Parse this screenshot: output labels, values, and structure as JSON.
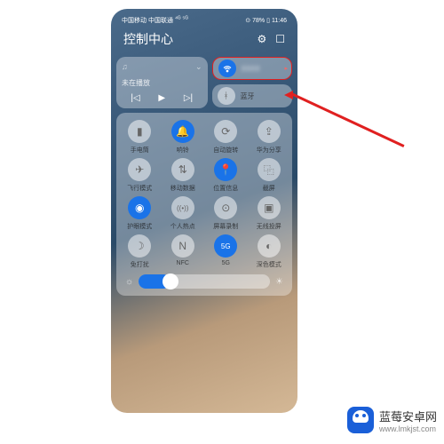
{
  "status": {
    "carrier1": "中国移动",
    "carrier2": "中国联通",
    "signal": "⁴ᴳ ⁵ᴳ",
    "vpn": "⊙",
    "battery": "78%",
    "time": "11:46"
  },
  "header": {
    "title": "控制中心"
  },
  "music": {
    "status": "未在播放",
    "prev": "|◁",
    "play": "▶",
    "next": "▷|",
    "note": "♫",
    "exp": "⌄"
  },
  "wifi": {
    "name": "XXXX"
  },
  "bt": {
    "label": "蓝牙"
  },
  "tiles": [
    {
      "label": "手电筒",
      "icon": "flashlight",
      "on": false
    },
    {
      "label": "响铃",
      "icon": "bell",
      "on": true
    },
    {
      "label": "自动旋转",
      "icon": "rotate",
      "on": false
    },
    {
      "label": "华为分享",
      "icon": "share",
      "on": false
    },
    {
      "label": "飞行模式",
      "icon": "airplane",
      "on": false
    },
    {
      "label": "移动数据",
      "icon": "data",
      "on": false
    },
    {
      "label": "位置信息",
      "icon": "location",
      "on": true
    },
    {
      "label": "截屏",
      "icon": "screenshot",
      "on": false
    },
    {
      "label": "护眼模式",
      "icon": "eye",
      "on": true
    },
    {
      "label": "个人热点",
      "icon": "hotspot",
      "on": false
    },
    {
      "label": "屏幕录制",
      "icon": "record",
      "on": false
    },
    {
      "label": "无线投屏",
      "icon": "cast",
      "on": false
    },
    {
      "label": "免打扰",
      "icon": "dnd",
      "on": false
    },
    {
      "label": "NFC",
      "icon": "nfc",
      "on": false
    },
    {
      "label": "5G",
      "icon": "5g",
      "on": true
    },
    {
      "label": "深色模式",
      "icon": "dark",
      "on": false
    }
  ],
  "brightness": {
    "value": 24
  },
  "watermark": {
    "title": "蓝莓安卓网",
    "url": "www.lmkjst.com"
  },
  "glyph": {
    "flashlight": "▮",
    "bell": "🔔",
    "rotate": "⟳",
    "share": "⇪",
    "airplane": "✈",
    "data": "⇅",
    "location": "📍",
    "screenshot": "⿻",
    "eye": "◉",
    "hotspot": "((•))",
    "record": "⊙",
    "cast": "▣",
    "dnd": "☽",
    "nfc": "N",
    "5g": "5G",
    "dark": "◐",
    "gear": "⚙",
    "edit": "☐",
    "wifi": "⌇",
    "bluetooth": "ᚼ"
  }
}
